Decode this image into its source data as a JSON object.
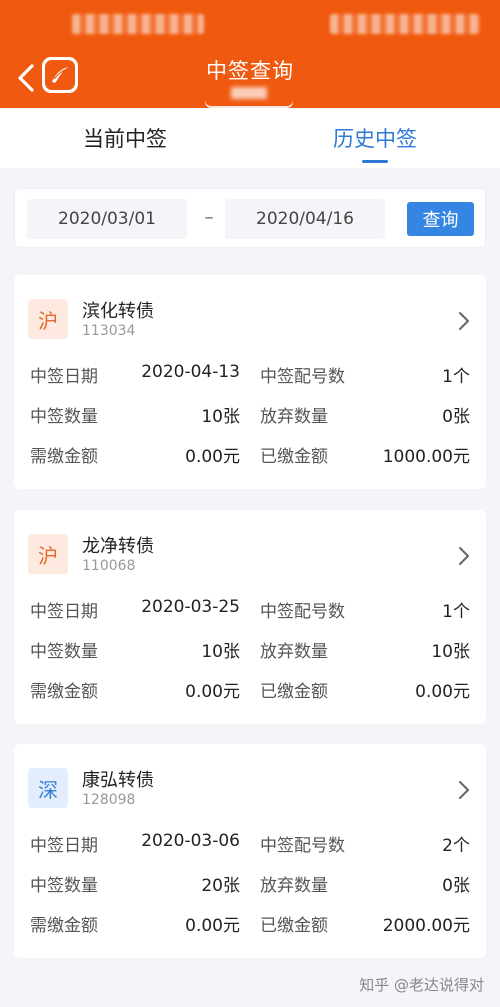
{
  "header": {
    "title": "中签查询",
    "back_icon": "chevron-left-icon",
    "logo_icon": "app-logo-icon"
  },
  "tabs": [
    {
      "label": "当前中签",
      "active": false
    },
    {
      "label": "历史中签",
      "active": true
    }
  ],
  "query": {
    "start_date": "2020/03/01",
    "separator": "–",
    "end_date": "2020/04/16",
    "button_label": "查询"
  },
  "records": [
    {
      "market": "沪",
      "market_type": "sh",
      "name": "滨化转债",
      "code": "113034",
      "rows": [
        {
          "l1": "中签日期",
          "v1": "2020-04-13",
          "l2": "中签配号数",
          "v2": "1个"
        },
        {
          "l1": "中签数量",
          "v1": "10张",
          "l2": "放弃数量",
          "v2": "0张"
        },
        {
          "l1": "需缴金额",
          "v1": "0.00元",
          "l2": "已缴金额",
          "v2": "1000.00元"
        }
      ]
    },
    {
      "market": "沪",
      "market_type": "sh",
      "name": "龙净转债",
      "code": "110068",
      "rows": [
        {
          "l1": "中签日期",
          "v1": "2020-03-25",
          "l2": "中签配号数",
          "v2": "1个"
        },
        {
          "l1": "中签数量",
          "v1": "10张",
          "l2": "放弃数量",
          "v2": "10张"
        },
        {
          "l1": "需缴金额",
          "v1": "0.00元",
          "l2": "已缴金额",
          "v2": "0.00元"
        }
      ]
    },
    {
      "market": "深",
      "market_type": "sz",
      "name": "康弘转债",
      "code": "128098",
      "rows": [
        {
          "l1": "中签日期",
          "v1": "2020-03-06",
          "l2": "中签配号数",
          "v2": "2个"
        },
        {
          "l1": "中签数量",
          "v1": "20张",
          "l2": "放弃数量",
          "v2": "0张"
        },
        {
          "l1": "需缴金额",
          "v1": "0.00元",
          "l2": "已缴金额",
          "v2": "2000.00元"
        }
      ]
    }
  ],
  "watermark": "知乎 @老达说得对",
  "colors": {
    "header": "#ef5a10",
    "accent": "#2f78d6",
    "button": "#3585e3",
    "sh_badge": "#e36b2a",
    "sz_badge": "#3680d8"
  }
}
